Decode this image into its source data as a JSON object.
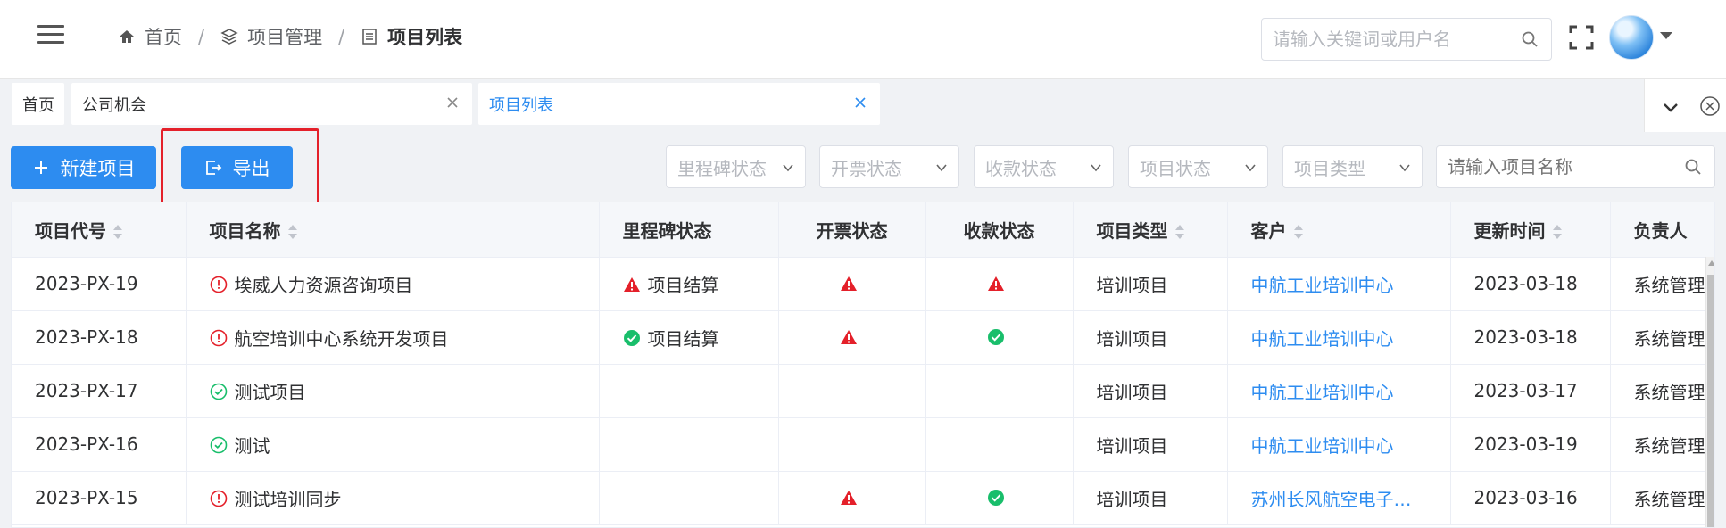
{
  "header": {
    "breadcrumb": [
      {
        "label": "首页",
        "icon": "home-icon"
      },
      {
        "label": "项目管理",
        "icon": "layers-icon"
      },
      {
        "label": "项目列表",
        "icon": "list-icon"
      }
    ],
    "separator": "/",
    "search_placeholder": "请输入关键词或用户名"
  },
  "tabs": [
    {
      "label": "首页"
    },
    {
      "label": "公司机会"
    },
    {
      "label": "项目列表",
      "active": true
    }
  ],
  "toolbar": {
    "new_project_label": "新建项目",
    "export_label": "导出",
    "filters": [
      "里程碑状态",
      "开票状态",
      "收款状态",
      "项目状态",
      "项目类型"
    ],
    "name_search_placeholder": "请输入项目名称"
  },
  "table": {
    "columns": [
      "项目代号",
      "项目名称",
      "里程碑状态",
      "开票状态",
      "收款状态",
      "项目类型",
      "客户",
      "更新时间",
      "负责人"
    ],
    "rows": [
      {
        "code": "2023-PX-19",
        "name_status": "warning",
        "name": "埃威人力资源咨询项目",
        "milestone_icon": "warning",
        "milestone": "项目结算",
        "invoice": "warning",
        "payment": "warning",
        "type": "培训项目",
        "customer": "中航工业培训中心",
        "updated": "2023-03-18",
        "owner": "系统管理员"
      },
      {
        "code": "2023-PX-18",
        "name_status": "warning",
        "name": "航空培训中心系统开发项目",
        "milestone_icon": "success",
        "milestone": "项目结算",
        "invoice": "warning",
        "payment": "success",
        "type": "培训项目",
        "customer": "中航工业培训中心",
        "updated": "2023-03-18",
        "owner": "系统管理员"
      },
      {
        "code": "2023-PX-17",
        "name_status": "ok",
        "name": "测试项目",
        "milestone_icon": "",
        "milestone": "",
        "invoice": "",
        "payment": "",
        "type": "培训项目",
        "customer": "中航工业培训中心",
        "updated": "2023-03-17",
        "owner": "系统管理员"
      },
      {
        "code": "2023-PX-16",
        "name_status": "ok",
        "name": "测试",
        "milestone_icon": "",
        "milestone": "",
        "invoice": "",
        "payment": "",
        "type": "培训项目",
        "customer": "中航工业培训中心",
        "updated": "2023-03-19",
        "owner": "系统管理员"
      },
      {
        "code": "2023-PX-15",
        "name_status": "warning",
        "name": "测试培训同步",
        "milestone_icon": "",
        "milestone": "",
        "invoice": "warning",
        "payment": "success",
        "type": "培训项目",
        "customer": "苏州长风航空电子…",
        "updated": "2023-03-16",
        "owner": "系统管理员"
      }
    ]
  },
  "colors": {
    "primary": "#2d8cf0",
    "danger": "#e4202a",
    "success": "#19be6b",
    "highlight": "#e4202a"
  }
}
